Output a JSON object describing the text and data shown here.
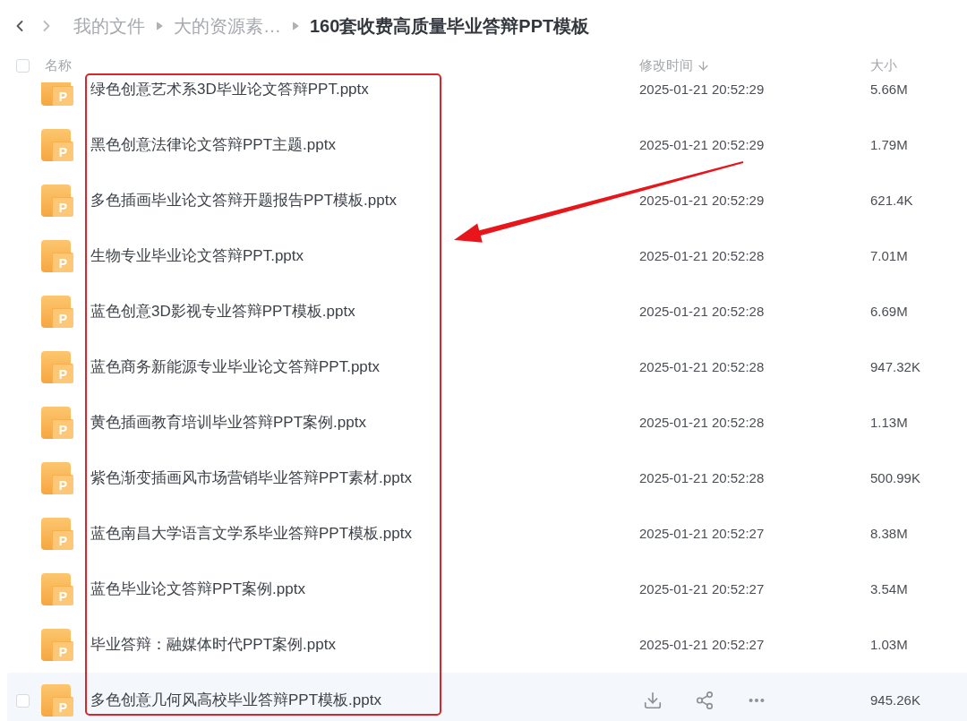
{
  "nav": {
    "back": {
      "disabled": false
    },
    "forward": {
      "disabled": true
    }
  },
  "breadcrumb": [
    {
      "label": "我的文件",
      "current": false
    },
    {
      "label": "大的资源素…",
      "current": false
    },
    {
      "label": "160套收费高质量毕业答辩PPT模板",
      "current": true
    }
  ],
  "table": {
    "select_all": {
      "checked": false
    },
    "columns": [
      {
        "label": "名称",
        "sorted": false
      },
      {
        "label": "修改时间",
        "sorted": true
      },
      {
        "label": "大小",
        "sorted": false
      }
    ],
    "rows": [
      {
        "icon_text": "P",
        "name": "绿色创意艺术系3D毕业论文答辩PPT.pptx",
        "modified": "2025-01-21 20:52:29",
        "size": "5.66M",
        "hovered": false,
        "checked": false
      },
      {
        "icon_text": "P",
        "name": "黑色创意法律论文答辩PPT主题.pptx",
        "modified": "2025-01-21 20:52:29",
        "size": "1.79M",
        "hovered": false,
        "checked": false
      },
      {
        "icon_text": "P",
        "name": "多色插画毕业论文答辩开题报告PPT模板.pptx",
        "modified": "2025-01-21 20:52:29",
        "size": "621.4K",
        "hovered": false,
        "checked": false
      },
      {
        "icon_text": "P",
        "name": "生物专业毕业论文答辩PPT.pptx",
        "modified": "2025-01-21 20:52:28",
        "size": "7.01M",
        "hovered": false,
        "checked": false
      },
      {
        "icon_text": "P",
        "name": "蓝色创意3D影视专业答辩PPT模板.pptx",
        "modified": "2025-01-21 20:52:28",
        "size": "6.69M",
        "hovered": false,
        "checked": false
      },
      {
        "icon_text": "P",
        "name": "蓝色商务新能源专业毕业论文答辩PPT.pptx",
        "modified": "2025-01-21 20:52:28",
        "size": "947.32K",
        "hovered": false,
        "checked": false
      },
      {
        "icon_text": "P",
        "name": "黄色插画教育培训毕业答辩PPT案例.pptx",
        "modified": "2025-01-21 20:52:28",
        "size": "1.13M",
        "hovered": false,
        "checked": false
      },
      {
        "icon_text": "P",
        "name": "紫色渐变插画风市场营销毕业答辩PPT素材.pptx",
        "modified": "2025-01-21 20:52:28",
        "size": "500.99K",
        "hovered": false,
        "checked": false
      },
      {
        "icon_text": "P",
        "name": "蓝色南昌大学语言文学系毕业答辩PPT模板.pptx",
        "modified": "2025-01-21 20:52:27",
        "size": "8.38M",
        "hovered": false,
        "checked": false
      },
      {
        "icon_text": "P",
        "name": "蓝色毕业论文答辩PPT案例.pptx",
        "modified": "2025-01-21 20:52:27",
        "size": "3.54M",
        "hovered": false,
        "checked": false
      },
      {
        "icon_text": "P",
        "name": "毕业答辩：融媒体时代PPT案例.pptx",
        "modified": "2025-01-21 20:52:27",
        "size": "1.03M",
        "hovered": false,
        "checked": false
      },
      {
        "icon_text": "P",
        "name": "多色创意几何风高校毕业答辩PPT模板.pptx",
        "size": "945.26K",
        "hovered": true,
        "checked": false
      }
    ]
  }
}
